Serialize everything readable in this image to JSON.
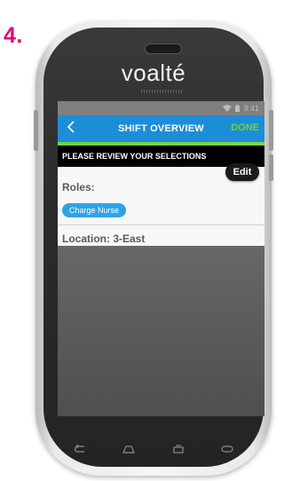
{
  "step_number": "4.",
  "device": {
    "brand": "voalté"
  },
  "status_bar": {
    "time": "9:41"
  },
  "app_bar": {
    "title": "SHIFT OVERVIEW",
    "done_label": "DONE"
  },
  "review": {
    "header": "PLEASE REVIEW YOUR SELECTIONS",
    "edit_label": "Edit",
    "roles_label": "Roles:",
    "roles": [
      "Charge Nurse"
    ],
    "location_label": "Location: 3-East"
  },
  "icons": {
    "back": "chevron-left-icon",
    "wifi": "wifi-icon",
    "battery": "battery-icon",
    "nav": [
      "back-arrow-icon",
      "home-icon",
      "recent-apps-icon",
      "menu-icon"
    ]
  },
  "colors": {
    "step_number": "#e6007e",
    "app_bar": "#1c8ed8",
    "done": "#6fd23a",
    "chip": "#2fa3e6",
    "header": "#000000"
  }
}
